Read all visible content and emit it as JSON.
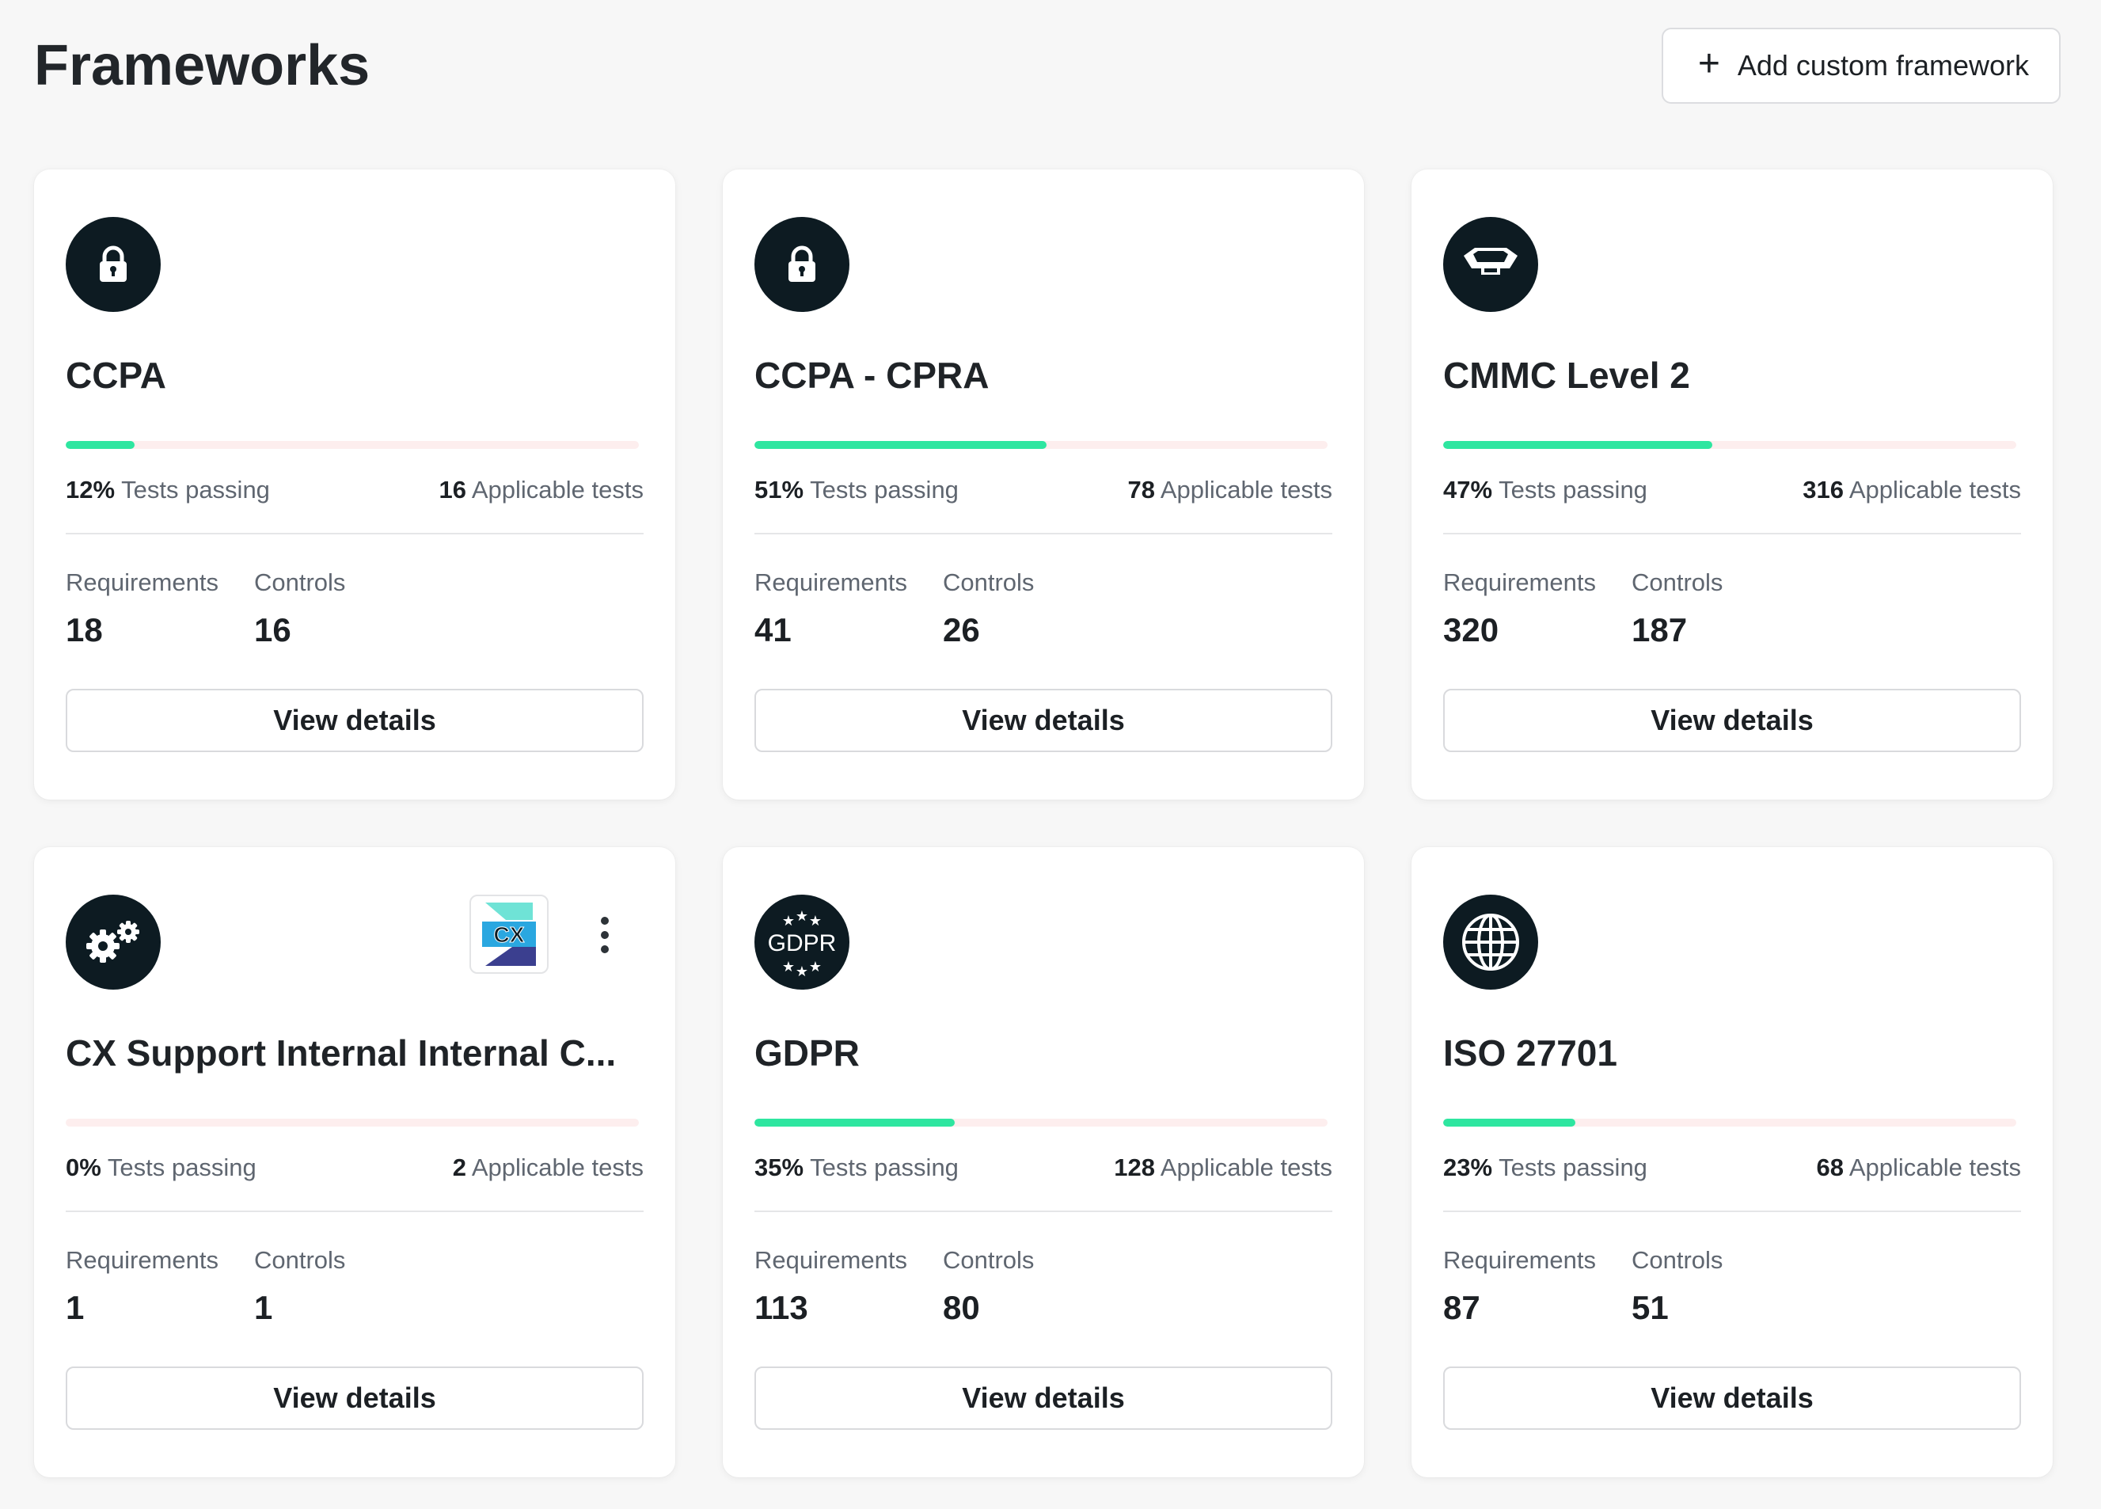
{
  "page": {
    "title": "Frameworks",
    "add_button_label": "Add custom framework",
    "add_button_icon": "plus-icon"
  },
  "colors": {
    "progress_fill": "#2ee6a0",
    "progress_track": "#fdeeee",
    "logo_bg": "#0d1b22"
  },
  "frameworks": [
    {
      "name": "CCPA",
      "icon": "lock-icon",
      "passing_pct": "12%",
      "passing_value": 0.12,
      "passing_label": "Tests passing",
      "applicable_count": "16",
      "applicable_label": "Applicable tests",
      "requirements_label": "Requirements",
      "requirements": "18",
      "controls_label": "Controls",
      "controls": "16",
      "button_label": "View details"
    },
    {
      "name": "CCPA - CPRA",
      "icon": "lock-icon",
      "passing_pct": "51%",
      "passing_value": 0.51,
      "passing_label": "Tests passing",
      "applicable_count": "78",
      "applicable_label": "Applicable tests",
      "requirements_label": "Requirements",
      "requirements": "41",
      "controls_label": "Controls",
      "controls": "26",
      "button_label": "View details"
    },
    {
      "name": "CMMC Level 2",
      "icon": "shield-emblem-icon",
      "passing_pct": "47%",
      "passing_value": 0.47,
      "passing_label": "Tests passing",
      "applicable_count": "316",
      "applicable_label": "Applicable tests",
      "requirements_label": "Requirements",
      "requirements": "320",
      "controls_label": "Controls",
      "controls": "187",
      "button_label": "View details"
    },
    {
      "name": "CX Support Internal Internal C...",
      "icon": "gears-icon",
      "badge_icon": "cx-logo-icon",
      "badge_text": "CX",
      "menu_icon": "more-vertical-icon",
      "passing_pct": "0%",
      "passing_value": 0,
      "passing_label": "Tests passing",
      "applicable_count": "2",
      "applicable_label": "Applicable tests",
      "requirements_label": "Requirements",
      "requirements": "1",
      "controls_label": "Controls",
      "controls": "1",
      "button_label": "View details"
    },
    {
      "name": "GDPR",
      "icon": "gdpr-stars-icon",
      "icon_text": "GDPR",
      "passing_pct": "35%",
      "passing_value": 0.35,
      "passing_label": "Tests passing",
      "applicable_count": "128",
      "applicable_label": "Applicable tests",
      "requirements_label": "Requirements",
      "requirements": "113",
      "controls_label": "Controls",
      "controls": "80",
      "button_label": "View details"
    },
    {
      "name": "ISO 27701",
      "icon": "globe-icon",
      "passing_pct": "23%",
      "passing_value": 0.23,
      "passing_label": "Tests passing",
      "applicable_count": "68",
      "applicable_label": "Applicable tests",
      "requirements_label": "Requirements",
      "requirements": "87",
      "controls_label": "Controls",
      "controls": "51",
      "button_label": "View details"
    }
  ]
}
